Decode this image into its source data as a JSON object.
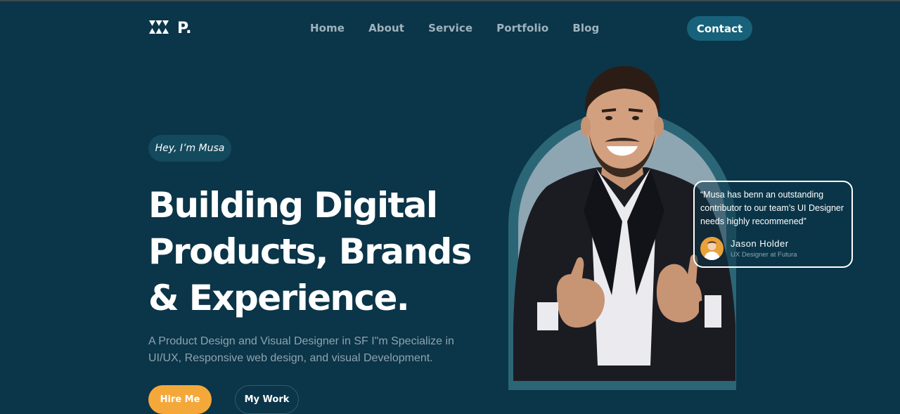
{
  "brand": {
    "logo_text": "P."
  },
  "nav": {
    "items": [
      {
        "label": "Home"
      },
      {
        "label": "About"
      },
      {
        "label": "Service"
      },
      {
        "label": "Portfolio"
      },
      {
        "label": "Blog"
      }
    ],
    "contact_label": "Contact"
  },
  "hero": {
    "greeting": "Hey, I’m Musa",
    "headline_lines": [
      "Building Digital",
      "Products, Brands",
      "& Experience."
    ],
    "description": "A Product Design and Visual Designer in SF I\"m Specialize in UI/UX, Responsive web design, and visual Development.",
    "hire_label": "Hire Me",
    "work_label": "My Work"
  },
  "testimonial": {
    "quote": "“Musa has benn an outstanding contributor to our team’s UI Designer needs highly recommened”",
    "author_name": "Jason Holder",
    "author_role": "UX Designer at Futura"
  },
  "colors": {
    "background": "#0b3548",
    "accent": "#17627a",
    "hire_button": "#f5a83a",
    "arch_outer": "#2b6677",
    "arch_inner": "#8ea6b2"
  },
  "icons": {
    "logo_mark": "triangles-logo-icon"
  }
}
